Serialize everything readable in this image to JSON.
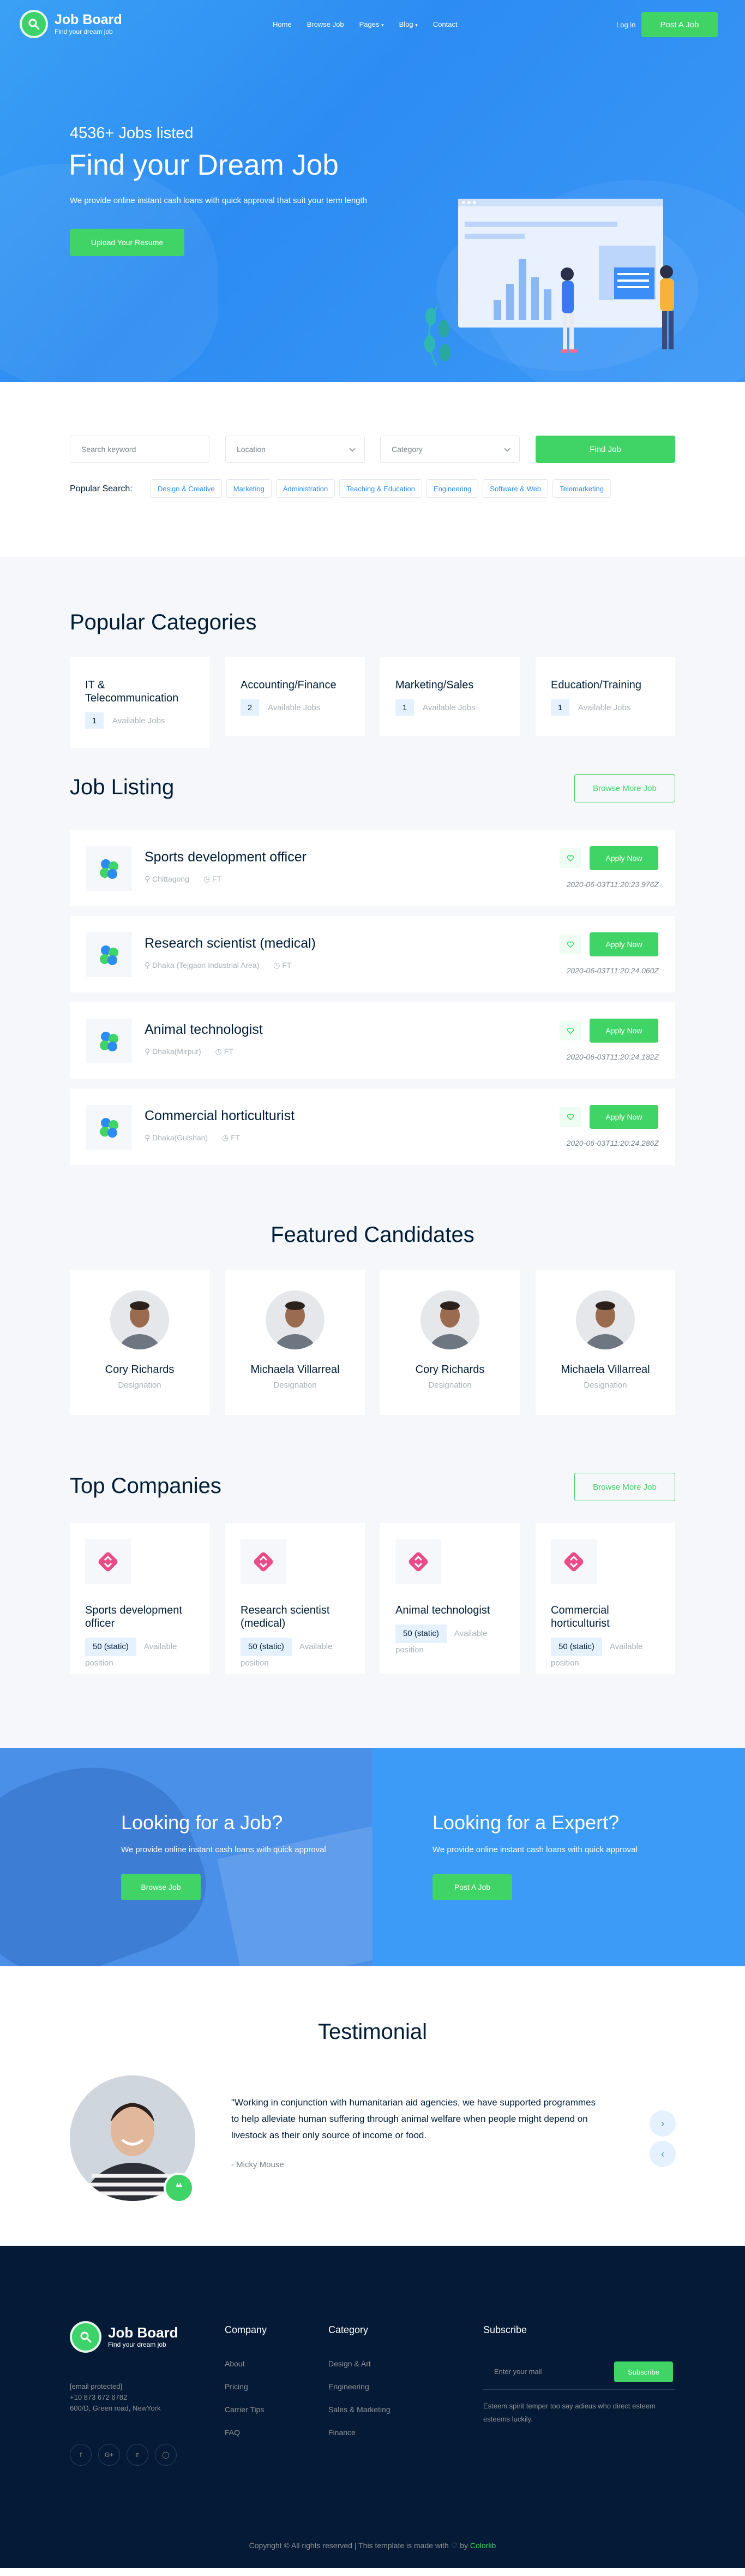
{
  "brand": {
    "name": "Job Board",
    "tagline": "Find your dream job",
    "accent": "#40d466",
    "primary": "#2d8cf2"
  },
  "nav": {
    "items": [
      "Home",
      "Browse Job",
      "Pages",
      "Blog",
      "Contact"
    ],
    "login": "Log in",
    "post_job": "Post A Job"
  },
  "hero": {
    "count": "4536+ Jobs listed",
    "title": "Find your Dream Job",
    "description": "We provide online instant cash loans with quick approval that suit your term length",
    "button": "Upload Your Resume"
  },
  "search": {
    "keyword_placeholder": "Search keyword",
    "location": "Location",
    "category": "Category",
    "button": "Find Job",
    "popular_label": "Popular Search:",
    "tags": [
      "Design & Creative",
      "Marketing",
      "Administration",
      "Teaching & Education",
      "Engineering",
      "Software & Web",
      "Telemarketing"
    ]
  },
  "categories": {
    "title": "Popular Categories",
    "available_label": "Available Jobs",
    "items": [
      {
        "name": "IT & Telecommunication",
        "count": "1"
      },
      {
        "name": "Accounting/Finance",
        "count": "2"
      },
      {
        "name": "Marketing/Sales",
        "count": "1"
      },
      {
        "name": "Education/Training",
        "count": "1"
      }
    ]
  },
  "jobs": {
    "title": "Job Listing",
    "browse_more": "Browse More Job",
    "apply_label": "Apply Now",
    "items": [
      {
        "title": "Sports development officer",
        "location": "Chittagong",
        "type": "FT",
        "date": "2020-06-03T11:20:23.976Z"
      },
      {
        "title": "Research scientist (medical)",
        "location": "Dhaka (Tejgaon Industrial Area)",
        "type": "FT",
        "date": "2020-06-03T11:20:24.060Z"
      },
      {
        "title": "Animal technologist",
        "location": "Dhaka(Mirpur)",
        "type": "FT",
        "date": "2020-06-03T11:20:24.182Z"
      },
      {
        "title": "Commercial horticulturist",
        "location": "Dhaka(Gulshan)",
        "type": "FT",
        "date": "2020-06-03T11:20:24.286Z"
      }
    ]
  },
  "candidates": {
    "title": "Featured Candidates",
    "items": [
      {
        "name": "Cory Richards",
        "role": "Designation"
      },
      {
        "name": "Michaela Villarreal",
        "role": "Designation"
      },
      {
        "name": "Cory Richards",
        "role": "Designation"
      },
      {
        "name": "Michaela Villarreal",
        "role": "Designation"
      }
    ]
  },
  "companies": {
    "title": "Top Companies",
    "browse_more": "Browse More Job",
    "available_label": "Available position",
    "items": [
      {
        "name": "Sports development officer",
        "count": "50 (static)"
      },
      {
        "name": "Research scientist (medical)",
        "count": "50 (static)"
      },
      {
        "name": "Animal technologist",
        "count": "50 (static)"
      },
      {
        "name": "Commercial horticulturist",
        "count": "50 (static)"
      }
    ]
  },
  "cta": {
    "left": {
      "title": "Looking for a Job?",
      "description": "We provide online instant cash loans with quick approval",
      "button": "Browse Job"
    },
    "right": {
      "title": "Looking for a Expert?",
      "description": "We provide online instant cash loans with quick approval",
      "button": "Post A Job"
    }
  },
  "testimonial": {
    "title": "Testimonial",
    "quote": "\"Working in conjunction with humanitarian aid agencies, we have supported programmes to help alleviate human suffering through animal welfare when people might depend on livestock as their only source of income or food.",
    "author": "- Micky Mouse"
  },
  "footer": {
    "email": "[email protected]",
    "phone": "+10 873 672 6782",
    "address": "600/D, Green road, NewYork",
    "company_title": "Company",
    "company_links": [
      "About",
      "Pricing",
      "Carrier Tips",
      "FAQ"
    ],
    "category_title": "Category",
    "category_links": [
      "Design & Art",
      "Engineering",
      "Sales & Marketing",
      "Finance"
    ],
    "subscribe_title": "Subscribe",
    "subscribe_placeholder": "Enter your mail",
    "subscribe_button": "Subscribe",
    "subscribe_note": "Esteem spirit temper too say adieus who direct esteem esteems luckily.",
    "copyright_prefix": "Copyright © All rights reserved | This template is made with",
    "copyright_by": "by",
    "copyright_brand": "Colorlib"
  }
}
